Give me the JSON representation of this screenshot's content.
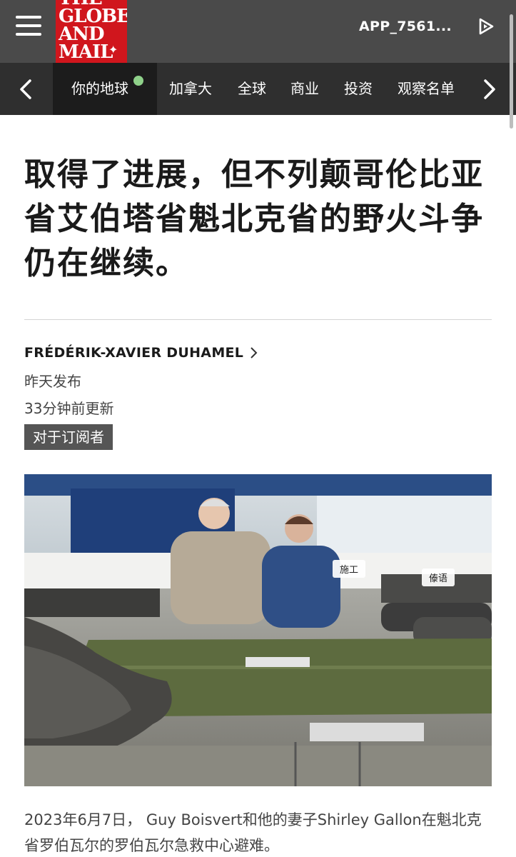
{
  "header": {
    "logo_lines": "THE\nGLOBE\nAND\nMAIL",
    "app_id": "APP_7561..."
  },
  "nav": {
    "items": [
      "你的地球",
      "加拿大",
      "全球",
      "商业",
      "投资",
      "观察名单"
    ]
  },
  "article": {
    "headline": "取得了进展，但不列颠哥伦比亚省艾伯塔省魁北克省的野火斗争仍在继续。",
    "author": "FRÉDÉRIK-XAVIER DUHAMEL",
    "published": "昨天发布",
    "updated": "33分钟前更新",
    "badge": "对于订阅者",
    "photo_tags": [
      "施工",
      "傣语"
    ],
    "caption": "2023年6月7日， Guy Boisvert和他的妻子Shirley Gallon在魁北克省罗伯瓦尔的罗伯瓦尔急救中心避难。"
  },
  "colors": {
    "brand_red": "#d0161d",
    "topbar": "#4a4a4a",
    "navbar": "#2f2f2f",
    "new_dot": "#8fd18a"
  },
  "icons": [
    "menu-icon",
    "play-icon",
    "chevron-left-icon",
    "chevron-right-icon"
  ]
}
